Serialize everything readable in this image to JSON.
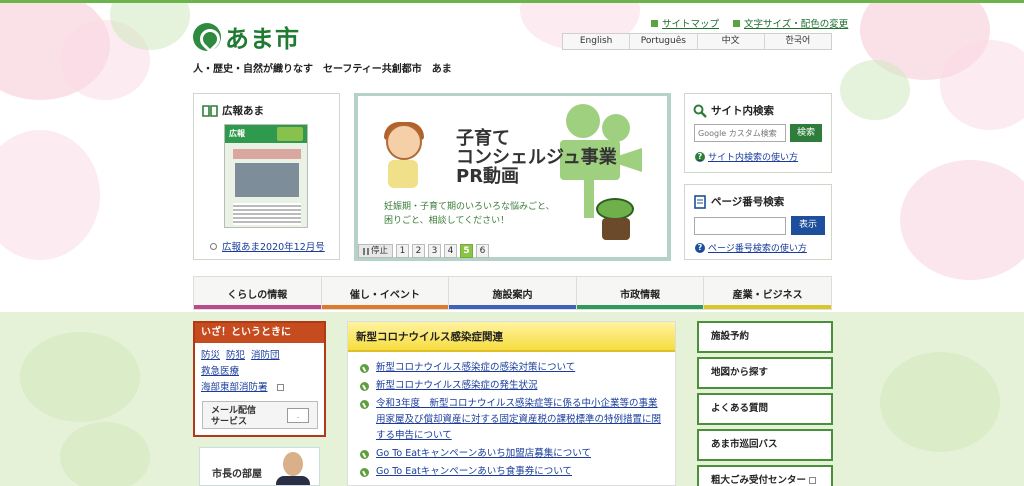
{
  "header": {
    "logo_text": "あま市",
    "tagline": "人・歴史・自然が織りなす　セーフティー共創都市　あま",
    "utility_links": [
      "サイトマップ",
      "文字サイズ・配色の変更"
    ],
    "languages": [
      "English",
      "Português",
      "中文",
      "한국어"
    ]
  },
  "koho": {
    "title": "広報あま",
    "cover_label": "広報",
    "link": "広報あま2020年12月号"
  },
  "slider": {
    "title": "子育て\nコンシェルジュ事業\nPR動画",
    "subtitle": "妊娠期・子育て期のいろいろな悩みごと、\n困りごと、相談してください！",
    "stop_label": "停止",
    "pages": [
      "1",
      "2",
      "3",
      "4",
      "5",
      "6"
    ],
    "active_page": "5"
  },
  "site_search": {
    "title": "サイト内検索",
    "placeholder": "Google カスタム検索",
    "button": "検索",
    "help": "サイト内検索の使い方"
  },
  "page_search": {
    "title": "ページ番号検索",
    "button": "表示",
    "help": "ページ番号検索の使い方"
  },
  "nav": {
    "items": [
      {
        "label": "くらしの情報",
        "color": "#b84b8c"
      },
      {
        "label": "催し・イベント",
        "color": "#e07a2a"
      },
      {
        "label": "施設案内",
        "color": "#3e63b8"
      },
      {
        "label": "市政情報",
        "color": "#2f9a5a"
      },
      {
        "label": "産業・ビジネス",
        "color": "#d9c62a"
      }
    ]
  },
  "emergency": {
    "title": "いざ！というときに",
    "links": [
      "防災",
      "防犯",
      "消防団",
      "救急医療",
      "海部東部消防署"
    ],
    "mail_label": "メール配信\nサービス"
  },
  "mayor": {
    "label": "市長の部屋"
  },
  "covid": {
    "title": "新型コロナウイルス感染症関連",
    "items": [
      "新型コロナウイルス感染症の感染対策について",
      "新型コロナウイルス感染症の発生状況",
      "令和3年度　新型コロナウイルス感染症等に係る中小企業等の事業用家屋及び償却資産に対する固定資産税の課税標準の特例措置に関する申告について",
      "Go To Eatキャンペーンあいち加盟店募集について",
      "Go To Eatキャンペーンあいち食事券について"
    ]
  },
  "right_nav": [
    "施設予約",
    "地図から探す",
    "よくある質問",
    "あま市巡回バス",
    "粗大ごみ受付センター"
  ]
}
